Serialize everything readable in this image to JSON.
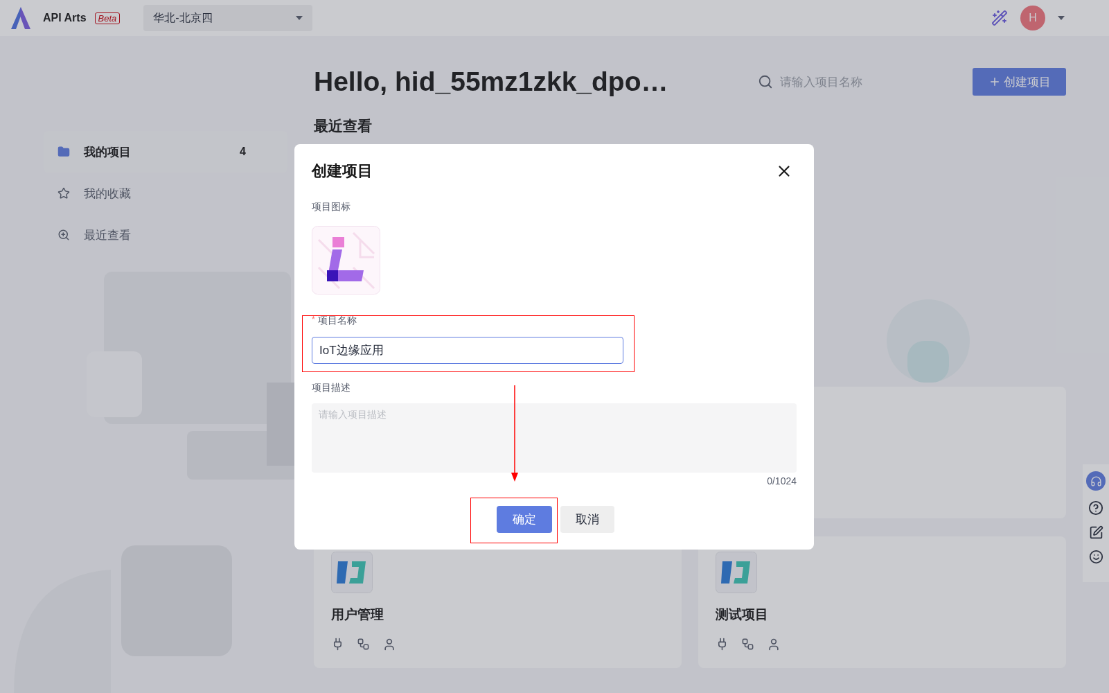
{
  "header": {
    "app_name": "API Arts",
    "badge": "Beta",
    "region": "华北-北京四",
    "avatar": "H"
  },
  "hero": {
    "greeting": "Hello, hid_55mz1zkk_dpo…",
    "search_placeholder": "请输入项目名称",
    "create_button": "创建项目"
  },
  "sidebar": {
    "items": [
      {
        "kind": "folder",
        "label": "我的项目",
        "count": "4",
        "selected": true
      },
      {
        "kind": "star",
        "label": "我的收藏",
        "selected": false
      },
      {
        "kind": "recent",
        "label": "最近查看",
        "selected": false
      }
    ]
  },
  "section_title": "最近查看",
  "projects": [
    {
      "name": "用户管理"
    },
    {
      "name": "测试项目"
    }
  ],
  "dialog": {
    "title": "创建项目",
    "icon_label": "项目图标",
    "name_label": "项目名称",
    "required_mark": "*",
    "name_value": "IoT边缘应用",
    "desc_label": "项目描述",
    "desc_placeholder": "请输入项目描述",
    "counter": "0/1024",
    "ok_button": "确定",
    "cancel_button": "取消"
  }
}
